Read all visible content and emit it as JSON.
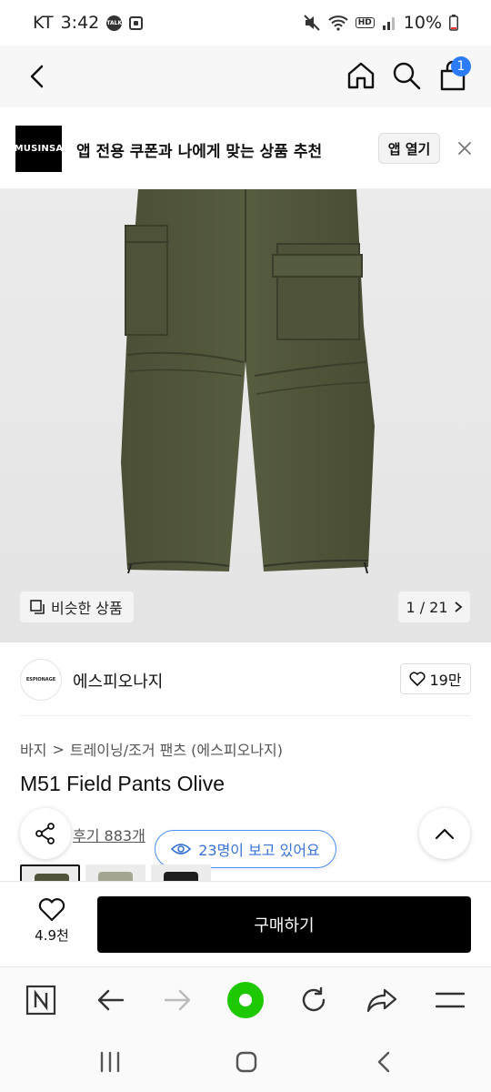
{
  "status_bar": {
    "carrier": "KT",
    "time": "3:42",
    "talk_badge": "TALK",
    "hd": "HD",
    "battery": "10%"
  },
  "nav": {
    "cart_count": "1"
  },
  "banner": {
    "logo_text": "MUSINSA",
    "text": "앱 전용 쿠폰과 나에게 맞는 상품 추천",
    "open_button": "앱 열기"
  },
  "image_overlay": {
    "similar_label": "비슷한 상품",
    "pager": "1 / 21"
  },
  "brand": {
    "logo_text": "ESPIONAGE",
    "name": "에스피오나지",
    "like_count": "19만"
  },
  "breadcrumb": {
    "level1": "바지",
    "separator": ">",
    "level2": "트레이닝/조거 팬츠 (에스피오나지)"
  },
  "product": {
    "title": "M51 Field Pants Olive",
    "review_link": "후기 883개",
    "viewers": "23명이 보고 있어요"
  },
  "buy_bar": {
    "wish_count": "4.9천",
    "buy_label": "구매하기"
  },
  "colors": {
    "accent_blue": "#2b7cf6",
    "olive": "#4f5438",
    "naver_green": "#1ec800"
  }
}
